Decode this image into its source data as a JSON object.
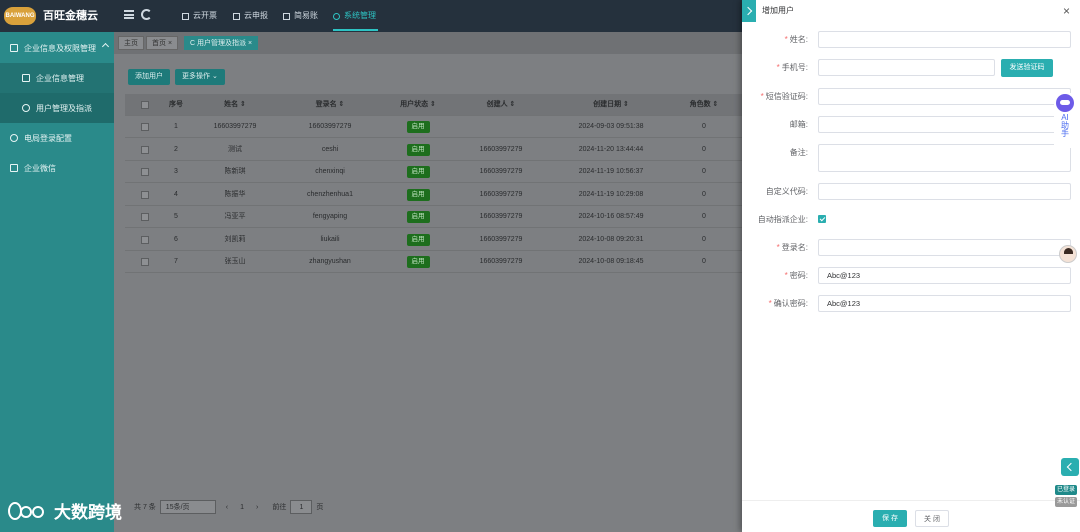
{
  "app": {
    "logo_text": "百旺金穗云",
    "brand": "百旺金穗云"
  },
  "topnav": [
    {
      "label": "云开票",
      "icon": "grid-icon"
    },
    {
      "label": "云申报",
      "icon": "crop-icon"
    },
    {
      "label": "简易账",
      "icon": "book-icon"
    },
    {
      "label": "系统管理",
      "icon": "gear-icon",
      "active": true
    }
  ],
  "sidebar": {
    "items": [
      {
        "label": "企业信息及权限管理",
        "icon": "building-icon"
      },
      {
        "label": "企业信息管理",
        "icon": "company-icon"
      },
      {
        "label": "用户管理及指派",
        "icon": "user-icon"
      },
      {
        "label": "电局登录配置",
        "icon": "gear-icon"
      },
      {
        "label": "企业微信",
        "icon": "wechat-icon"
      }
    ]
  },
  "watermark": "大数跨境",
  "tabs": [
    {
      "label": "主页"
    },
    {
      "label": "首页 ×"
    },
    {
      "label": "C 用户管理及指派 ×"
    }
  ],
  "toolbar": {
    "add_user": "添加用户",
    "more_ops": "更多操作 ⌄"
  },
  "table": {
    "columns": [
      "序号",
      "姓名 ⇕",
      "登录名 ⇕",
      "用户状态 ⇕",
      "创建人 ⇕",
      "创建日期 ⇕",
      "角色数 ⇕"
    ],
    "rows": [
      {
        "no": "1",
        "name": "16603997279",
        "login": "16603997279",
        "status": "启用",
        "creator": "",
        "date": "2024-09-03 09:51:38",
        "roles": "0"
      },
      {
        "no": "2",
        "name": "测试",
        "login": "ceshi",
        "status": "启用",
        "creator": "16603997279",
        "date": "2024-11-20 13:44:44",
        "roles": "0"
      },
      {
        "no": "3",
        "name": "陈新琪",
        "login": "chenxinqi",
        "status": "启用",
        "creator": "16603997279",
        "date": "2024-11-19 10:56:37",
        "roles": "0"
      },
      {
        "no": "4",
        "name": "陈振华",
        "login": "chenzhenhua1",
        "status": "启用",
        "creator": "16603997279",
        "date": "2024-11-19 10:29:08",
        "roles": "0"
      },
      {
        "no": "5",
        "name": "冯亚平",
        "login": "fengyaping",
        "status": "启用",
        "creator": "16603997279",
        "date": "2024-10-16 08:57:49",
        "roles": "0"
      },
      {
        "no": "6",
        "name": "刘凯莉",
        "login": "liukaili",
        "status": "启用",
        "creator": "16603997279",
        "date": "2024-10-08 09:20:31",
        "roles": "0"
      },
      {
        "no": "7",
        "name": "张玉山",
        "login": "zhangyushan",
        "status": "启用",
        "creator": "16603997279",
        "date": "2024-10-08 09:18:45",
        "roles": "0"
      }
    ]
  },
  "pager": {
    "total_prefix": "共 7 条",
    "page_size": "15条/页",
    "prev": "‹",
    "page": "1",
    "next": "›",
    "goto": "前往",
    "goto_page": "1",
    "page_unit": "页"
  },
  "drawer": {
    "title": "增加用户",
    "close": "×",
    "fields": {
      "name": {
        "label": "姓名:",
        "required": true,
        "value": ""
      },
      "phone": {
        "label": "手机号:",
        "required": true,
        "value": ""
      },
      "sms_code": {
        "label": "短信验证码:",
        "required": true,
        "value": ""
      },
      "email": {
        "label": "邮箱:",
        "required": false,
        "value": ""
      },
      "note": {
        "label": "备注:",
        "required": false,
        "value": ""
      },
      "custom_code": {
        "label": "自定义代码:",
        "required": false,
        "value": ""
      },
      "auto_assign": {
        "label": "自动指派企业:",
        "checked": true
      },
      "login_name": {
        "label": "登录名:",
        "required": true,
        "value": ""
      },
      "password": {
        "label": "密码:",
        "required": true,
        "value": "Abc@123"
      },
      "confirm_password": {
        "label": "确认密码:",
        "required": true,
        "value": "Abc@123"
      }
    },
    "send_code": "发送验证码",
    "save": "保 存",
    "close_btn": "关 闭"
  },
  "ai_helper": {
    "label": "AI\n助\n手"
  },
  "login_status": {
    "logged": "已登录",
    "unverified": "未认证"
  },
  "colors": {
    "accent": "#2aaeb0",
    "sidebar": "#2a8a8a",
    "topbar": "#25313d",
    "required": "#f56c6c"
  }
}
